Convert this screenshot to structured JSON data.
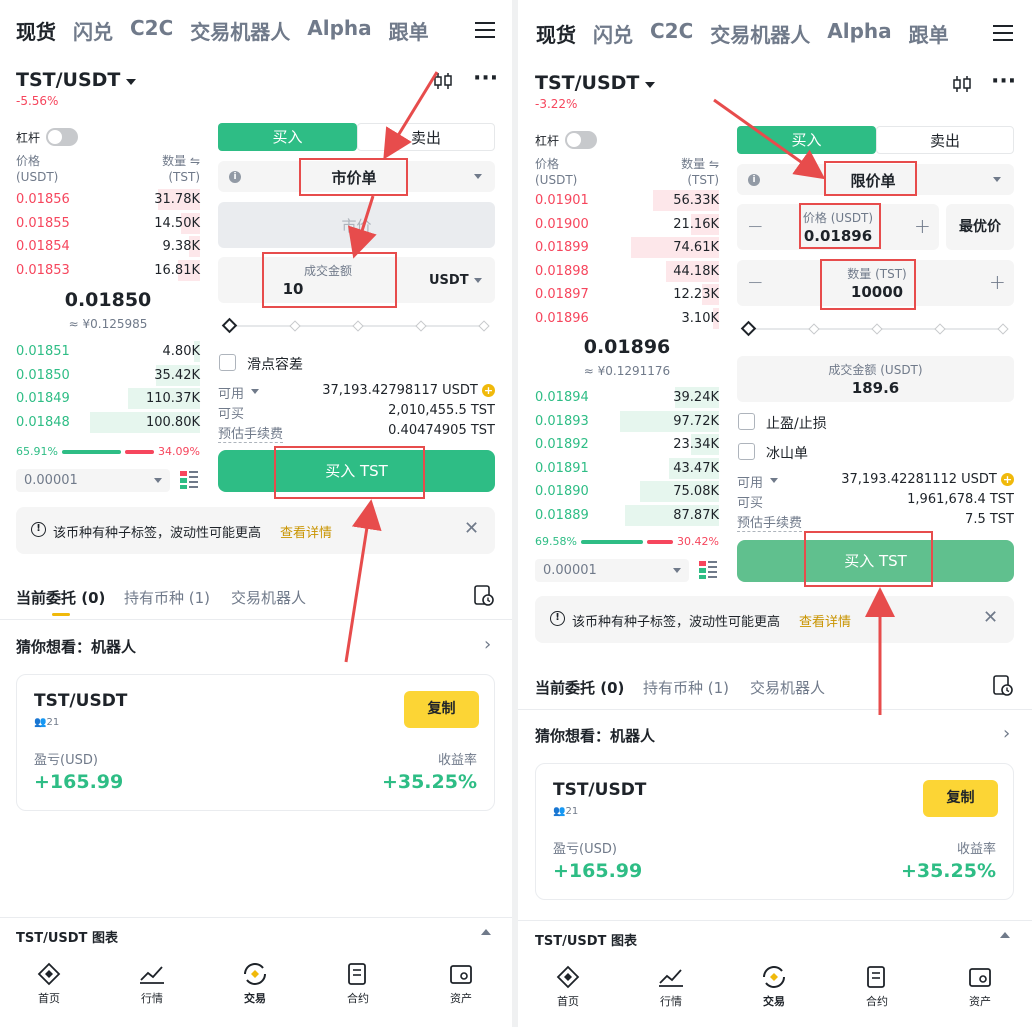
{
  "nav": {
    "tabs": [
      "现货",
      "闪兑",
      "C2C",
      "交易机器人",
      "Alpha",
      "跟单"
    ]
  },
  "left": {
    "pair": "TST/USDT",
    "change": "-5.56%",
    "leverage_label": "杠杆",
    "book_header": {
      "price_label": "价格",
      "price_unit": "(USDT)",
      "qty_label": "数量 ⇋",
      "qty_unit": "(TST)"
    },
    "asks": [
      {
        "price": "0.01856",
        "qty": "31.78K",
        "depth": 0.38
      },
      {
        "price": "0.01855",
        "qty": "14.50K",
        "depth": 0.17
      },
      {
        "price": "0.01854",
        "qty": "9.38K",
        "depth": 0.1
      },
      {
        "price": "0.01853",
        "qty": "16.81K",
        "depth": 0.2
      }
    ],
    "last_price": "0.01850",
    "last_cny": "≈ ¥0.125985",
    "bids": [
      {
        "price": "0.01851",
        "qty": "4.80K",
        "depth": 0.05
      },
      {
        "price": "0.01850",
        "qty": "35.42K",
        "depth": 0.4
      },
      {
        "price": "0.01849",
        "qty": "110.37K",
        "depth": 0.65
      },
      {
        "price": "0.01848",
        "qty": "100.80K",
        "depth": 1.0
      }
    ],
    "ratio_buy": "65.91%",
    "ratio_sell": "34.09%",
    "precision": "0.00001",
    "buy_tab": "买入",
    "sell_tab": "卖出",
    "order_type": "市价单",
    "price_placeholder": "市价",
    "amount_label": "成交金额",
    "amount_value": "10",
    "amount_unit": "USDT",
    "slippage_label": "滑点容差",
    "available_label": "可用",
    "available_value": "37,193.42798117 USDT",
    "can_buy_label": "可买",
    "can_buy_value": "2,010,455.5 TST",
    "fee_label": "预估手续费",
    "fee_value": "0.40474905 TST",
    "buy_button": "买入 TST",
    "notice_text": "该币种有种子标签，波动性可能更高",
    "notice_link": "查看详情",
    "tabs": [
      "当前委托 (0)",
      "持有币种 (1)",
      "交易机器人"
    ],
    "guess_label": "猜你想看：",
    "guess_value": "机器人",
    "card": {
      "pair": "TST/USDT",
      "users": "21",
      "copy": "复制",
      "pnl_label": "盈亏(USD)",
      "pnl_value": "+165.99",
      "roi_label": "收益率",
      "roi_value": "+35.25%"
    },
    "chart_label": "TST/USDT 图表"
  },
  "right": {
    "pair": "TST/USDT",
    "change": "-3.22%",
    "leverage_label": "杠杆",
    "book_header": {
      "price_label": "价格",
      "price_unit": "(USDT)",
      "qty_label": "数量 ⇋",
      "qty_unit": "(TST)"
    },
    "asks": [
      {
        "price": "0.01901",
        "qty": "56.33K",
        "depth": 0.6
      },
      {
        "price": "0.01900",
        "qty": "21.16K",
        "depth": 0.25
      },
      {
        "price": "0.01899",
        "qty": "74.61K",
        "depth": 0.8
      },
      {
        "price": "0.01898",
        "qty": "44.18K",
        "depth": 0.48
      },
      {
        "price": "0.01897",
        "qty": "12.23K",
        "depth": 0.15
      },
      {
        "price": "0.01896",
        "qty": "3.10K",
        "depth": 0.05
      }
    ],
    "last_price": "0.01896",
    "last_cny": "≈ ¥0.1291176",
    "bids": [
      {
        "price": "0.01894",
        "qty": "39.24K",
        "depth": 0.4
      },
      {
        "price": "0.01893",
        "qty": "97.72K",
        "depth": 0.9
      },
      {
        "price": "0.01892",
        "qty": "23.34K",
        "depth": 0.25
      },
      {
        "price": "0.01891",
        "qty": "43.47K",
        "depth": 0.45
      },
      {
        "price": "0.01890",
        "qty": "75.08K",
        "depth": 0.72
      },
      {
        "price": "0.01889",
        "qty": "87.87K",
        "depth": 0.85
      }
    ],
    "ratio_buy": "69.58%",
    "ratio_sell": "30.42%",
    "precision": "0.00001",
    "buy_tab": "买入",
    "sell_tab": "卖出",
    "order_type": "限价单",
    "price_label": "价格 (USDT)",
    "price_value": "0.01896",
    "best_price": "最优价",
    "qty_label": "数量 (TST)",
    "qty_value": "10000",
    "total_label": "成交金额 (USDT)",
    "total_value": "189.6",
    "tp_label": "止盈/止损",
    "iceberg_label": "冰山单",
    "available_label": "可用",
    "available_value": "37,193.42281112 USDT",
    "can_buy_label": "可买",
    "can_buy_value": "1,961,678.4 TST",
    "fee_label": "预估手续费",
    "fee_value": "7.5 TST",
    "buy_button": "买入 TST",
    "notice_text": "该币种有种子标签，波动性可能更高",
    "notice_link": "查看详情",
    "tabs": [
      "当前委托 (0)",
      "持有币种 (1)",
      "交易机器人"
    ],
    "guess_label": "猜你想看：",
    "guess_value": "机器人",
    "card": {
      "pair": "TST/USDT",
      "users": "21",
      "copy": "复制",
      "pnl_label": "盈亏(USD)",
      "pnl_value": "+165.99",
      "roi_label": "收益率",
      "roi_value": "+35.25%"
    },
    "chart_label": "TST/USDT 图表"
  },
  "bottom_nav": [
    "首页",
    "行情",
    "交易",
    "合约",
    "资产"
  ],
  "colors": {
    "buy": "#2ebd85",
    "sell": "#f6465d",
    "accent": "#f0b90b",
    "annotation": "#e74c4c"
  }
}
